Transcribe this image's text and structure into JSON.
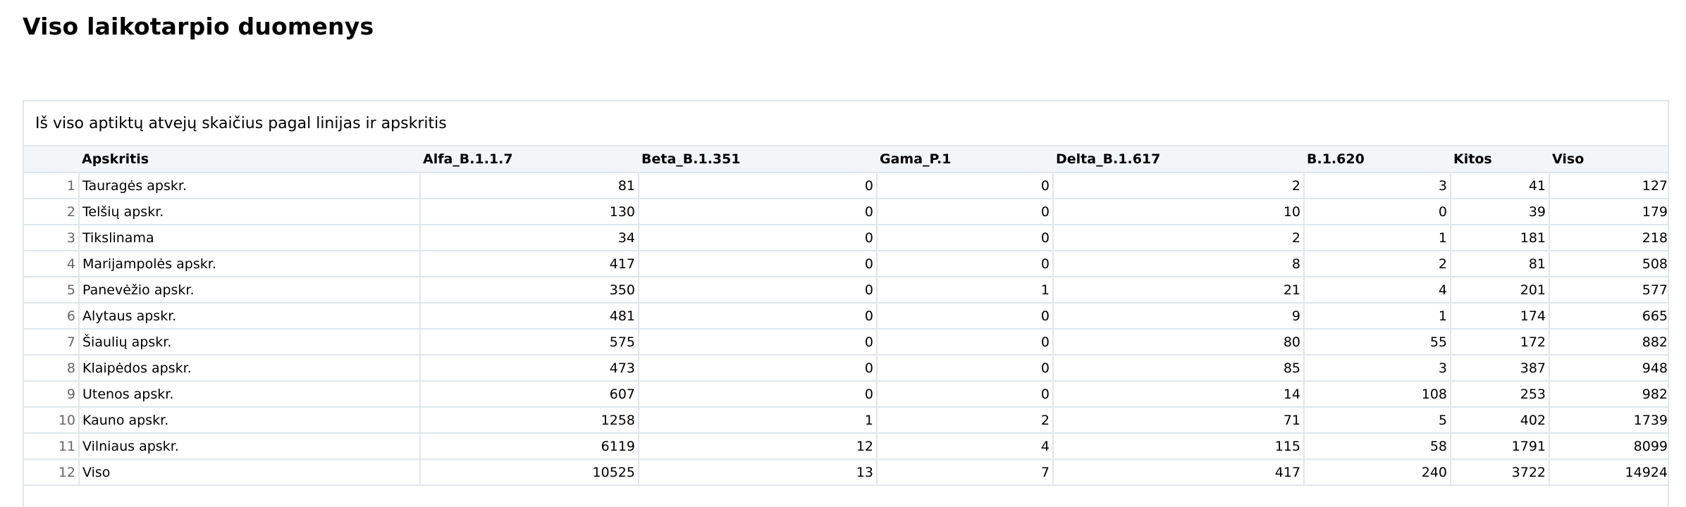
{
  "page": {
    "title": "Viso laikotarpio duomenys"
  },
  "panel": {
    "title": "Iš viso aptiktų atvejų skaičius pagal linijas ir apskritis"
  },
  "table": {
    "headers": [
      "Apskritis",
      "Alfa_B.1.1.7",
      "Beta_B.1.351",
      "Gama_P.1",
      "Delta_B.1.617",
      "B.1.620",
      "Kitos",
      "Viso"
    ],
    "rows": [
      {
        "n": "1",
        "cells": [
          "Tauragės apskr.",
          "81",
          "0",
          "0",
          "2",
          "3",
          "41",
          "127"
        ]
      },
      {
        "n": "2",
        "cells": [
          "Telšių apskr.",
          "130",
          "0",
          "0",
          "10",
          "0",
          "39",
          "179"
        ]
      },
      {
        "n": "3",
        "cells": [
          "Tikslinama",
          "34",
          "0",
          "0",
          "2",
          "1",
          "181",
          "218"
        ]
      },
      {
        "n": "4",
        "cells": [
          "Marijampolės apskr.",
          "417",
          "0",
          "0",
          "8",
          "2",
          "81",
          "508"
        ]
      },
      {
        "n": "5",
        "cells": [
          "Panevėžio apskr.",
          "350",
          "0",
          "1",
          "21",
          "4",
          "201",
          "577"
        ]
      },
      {
        "n": "6",
        "cells": [
          "Alytaus apskr.",
          "481",
          "0",
          "0",
          "9",
          "1",
          "174",
          "665"
        ]
      },
      {
        "n": "7",
        "cells": [
          "Šiaulių apskr.",
          "575",
          "0",
          "0",
          "80",
          "55",
          "172",
          "882"
        ]
      },
      {
        "n": "8",
        "cells": [
          "Klaipėdos apskr.",
          "473",
          "0",
          "0",
          "85",
          "3",
          "387",
          "948"
        ]
      },
      {
        "n": "9",
        "cells": [
          "Utenos apskr.",
          "607",
          "0",
          "0",
          "14",
          "108",
          "253",
          "982"
        ]
      },
      {
        "n": "10",
        "cells": [
          "Kauno apskr.",
          "1258",
          "1",
          "2",
          "71",
          "5",
          "402",
          "1739"
        ]
      },
      {
        "n": "11",
        "cells": [
          "Vilniaus apskr.",
          "6119",
          "12",
          "4",
          "115",
          "58",
          "1791",
          "8099"
        ]
      },
      {
        "n": "12",
        "cells": [
          "Viso",
          "10525",
          "13",
          "7",
          "417",
          "240",
          "3722",
          "14924"
        ]
      }
    ]
  }
}
